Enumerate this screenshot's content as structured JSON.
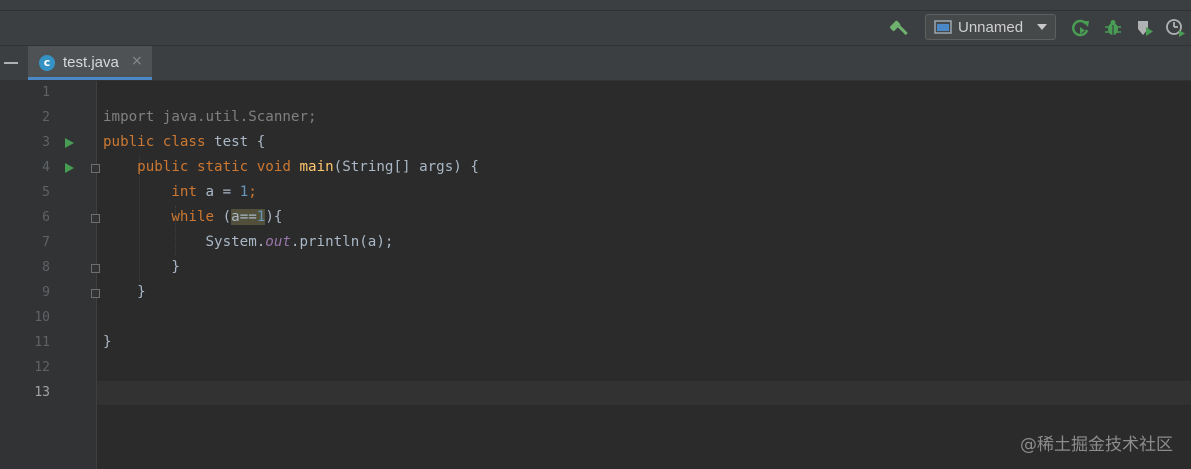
{
  "toolbar": {
    "run_config": "Unnamed",
    "icons": [
      "build-icon",
      "run-config-icon",
      "rerun-icon",
      "debug-icon",
      "coverage-icon",
      "profiler-icon"
    ],
    "colors": {
      "build": "#6fb26f",
      "run": "#499c54"
    }
  },
  "tabs": [
    {
      "label": "test.java",
      "icon": "c",
      "close": "×",
      "active": true
    }
  ],
  "gutter": {
    "line_numbers": [
      "1",
      "2",
      "3",
      "4",
      "5",
      "6",
      "7",
      "8",
      "9",
      "10",
      "11",
      "12",
      "13"
    ],
    "current_line": "13"
  },
  "code": {
    "l2": {
      "kw": "import",
      "rest": " java.util.Scanner;"
    },
    "l3": {
      "kw1": "public",
      "kw2": "class",
      "rest": " test {"
    },
    "l4": {
      "kw1": "public",
      "kw2": "static",
      "kw3": "void",
      "fn": "main",
      "rest": "(String[] args) {"
    },
    "l5": {
      "kw": "int",
      "mid": " a = ",
      "num": "1",
      "end": ";"
    },
    "l6": {
      "kw": "while",
      "open": " (",
      "hl_a": "a==",
      "hl_num": "1",
      "close": "){"
    },
    "l7": {
      "pre": "System.",
      "field": "out",
      "post": ".println(a);"
    },
    "l8": {
      "text": "}"
    },
    "l9": {
      "text": "}"
    },
    "l11": {
      "text": "}"
    }
  },
  "watermark": "@稀土掘金技术社区",
  "colors": {
    "background": "#2b2b2b",
    "keyword": "#cc7832",
    "function": "#ffc66d",
    "number": "#6897bb",
    "field": "#9876aa",
    "text": "#a9b7c6",
    "tab_underline": "#4a88c7"
  }
}
